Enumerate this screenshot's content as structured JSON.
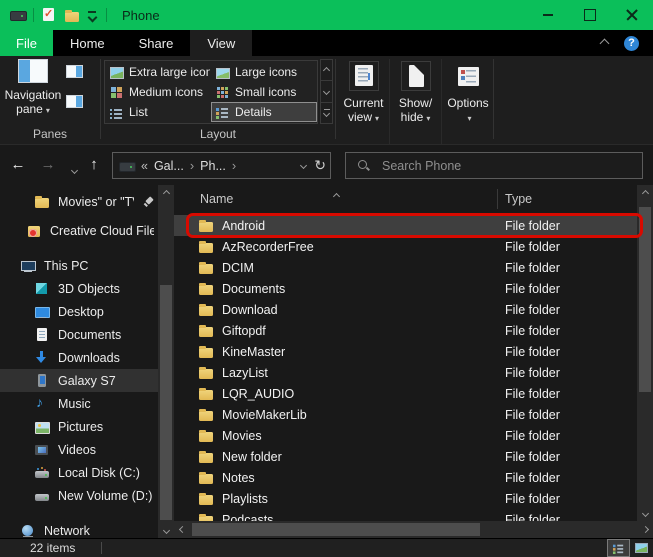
{
  "window": {
    "title": "Phone"
  },
  "icons": {
    "help": "?",
    "caret_down": "▾",
    "back": "←",
    "forward": "→",
    "up": "↑",
    "refresh": "↻",
    "guillemet": "«",
    "crumb_sep": "›"
  },
  "tabs": {
    "file": "File",
    "items": [
      {
        "label": "Home"
      },
      {
        "label": "Share"
      },
      {
        "label": "View",
        "active": true
      }
    ]
  },
  "ribbon": {
    "panes": {
      "button_line1": "Navigation",
      "button_line2": "pane",
      "group_label": "Panes"
    },
    "layout": {
      "group_label": "Layout",
      "items": [
        {
          "label": "Extra large icons",
          "icon": "gxl"
        },
        {
          "label": "Large icons",
          "icon": "glg"
        },
        {
          "label": "Medium icons",
          "icon": "gmd"
        },
        {
          "label": "Small icons",
          "icon": "gsm"
        },
        {
          "label": "List",
          "icon": "glist"
        },
        {
          "label": "Details",
          "icon": "gdet",
          "selected": true
        }
      ]
    },
    "buttons": [
      {
        "line1": "Current",
        "line2": "view",
        "icon": "currentview"
      },
      {
        "line1": "Show/",
        "line2": "hide",
        "icon": "showhide"
      },
      {
        "line1": "Options",
        "line2": "",
        "icon": "options"
      }
    ]
  },
  "navbar": {
    "breadcrumbs": [
      {
        "label": "Gal..."
      },
      {
        "label": "Ph..."
      }
    ],
    "search_placeholder": "Search Phone"
  },
  "sidebar": {
    "items": [
      {
        "label": "Movies\" or \"TV sh",
        "icon": "folder",
        "lvl": 2,
        "pinned": true
      },
      {
        "label": "Creative Cloud Files",
        "icon": "cc",
        "lvl": 1,
        "gap": 6
      },
      {
        "label": "This PC",
        "icon": "pc",
        "lvl": 0,
        "gap": 12
      },
      {
        "label": "3D Objects",
        "icon": "cube",
        "lvl": 2
      },
      {
        "label": "Desktop",
        "icon": "desktop",
        "lvl": 2
      },
      {
        "label": "Documents",
        "icon": "doc",
        "lvl": 2
      },
      {
        "label": "Downloads",
        "icon": "download",
        "lvl": 2
      },
      {
        "label": "Galaxy S7",
        "icon": "phone",
        "lvl": 2,
        "selected": true
      },
      {
        "label": "Music",
        "icon": "music",
        "lvl": 2
      },
      {
        "label": "Pictures",
        "icon": "pictures",
        "lvl": 2
      },
      {
        "label": "Videos",
        "icon": "videos",
        "lvl": 2
      },
      {
        "label": "Local Disk (C:)",
        "icon": "diskc",
        "lvl": 2
      },
      {
        "label": "New Volume (D:)",
        "icon": "disk",
        "lvl": 2
      },
      {
        "label": "Network",
        "icon": "network",
        "lvl": 0,
        "gap": 12
      }
    ]
  },
  "filelist": {
    "columns": {
      "name": "Name",
      "type": "Type"
    },
    "rows": [
      {
        "name": "Android",
        "type": "File folder",
        "selected": true,
        "annotated": true
      },
      {
        "name": "AzRecorderFree",
        "type": "File folder"
      },
      {
        "name": "DCIM",
        "type": "File folder"
      },
      {
        "name": "Documents",
        "type": "File folder"
      },
      {
        "name": "Download",
        "type": "File folder"
      },
      {
        "name": "Giftopdf",
        "type": "File folder"
      },
      {
        "name": "KineMaster",
        "type": "File folder"
      },
      {
        "name": "LazyList",
        "type": "File folder"
      },
      {
        "name": "LQR_AUDIO",
        "type": "File folder"
      },
      {
        "name": "MovieMakerLib",
        "type": "File folder"
      },
      {
        "name": "Movies",
        "type": "File folder"
      },
      {
        "name": "New folder",
        "type": "File folder"
      },
      {
        "name": "Notes",
        "type": "File folder"
      },
      {
        "name": "Playlists",
        "type": "File folder"
      },
      {
        "name": "Podcasts",
        "type": "File folder"
      }
    ]
  },
  "statusbar": {
    "count": "22 items"
  }
}
